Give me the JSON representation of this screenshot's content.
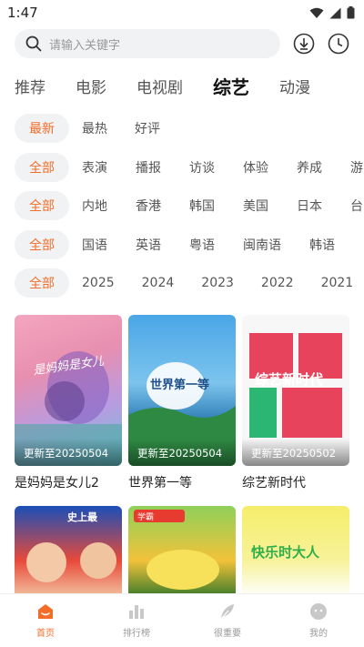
{
  "status": {
    "time": "1:47"
  },
  "search": {
    "placeholder": "请输入关键字"
  },
  "main_tabs": [
    "推荐",
    "电影",
    "电视剧",
    "综艺",
    "动漫"
  ],
  "sort": {
    "items": [
      "最新",
      "最热",
      "好评"
    ],
    "selected": "最新"
  },
  "type": {
    "all": "全部",
    "items": [
      "表演",
      "播报",
      "访谈",
      "体验",
      "养成",
      "游"
    ]
  },
  "region": {
    "all": "全部",
    "items": [
      "内地",
      "香港",
      "韩国",
      "美国",
      "日本",
      "台"
    ]
  },
  "language": {
    "all": "全部",
    "items": [
      "国语",
      "英语",
      "粤语",
      "闽南语",
      "韩语"
    ]
  },
  "year": {
    "all": "全部",
    "items": [
      "2025",
      "2024",
      "2023",
      "2022",
      "2021"
    ]
  },
  "cards": [
    {
      "title": "是妈妈是女儿2",
      "update": "更新至20250504",
      "poster_text": "是妈妈是女儿"
    },
    {
      "title": "世界第一等",
      "update": "更新至20250504",
      "poster_text": "世界第一等"
    },
    {
      "title": "综艺新时代",
      "update": "更新至20250502",
      "poster_text": "综艺新时代"
    }
  ],
  "cards_row2": [
    {
      "poster_text": "史上最"
    },
    {
      "poster_text": "学霸"
    },
    {
      "poster_text": "快乐时大人"
    }
  ],
  "bottom_nav": [
    {
      "label": "首页",
      "icon": "home-icon",
      "active": true
    },
    {
      "label": "排行榜",
      "icon": "chart-icon",
      "active": false
    },
    {
      "label": "很重要",
      "icon": "feather-icon",
      "active": false
    },
    {
      "label": "我的",
      "icon": "profile-icon",
      "active": false
    }
  ],
  "colors": {
    "accent": "#f36d29",
    "chip_bg": "#f1f2f4",
    "inactive": "#999999"
  }
}
